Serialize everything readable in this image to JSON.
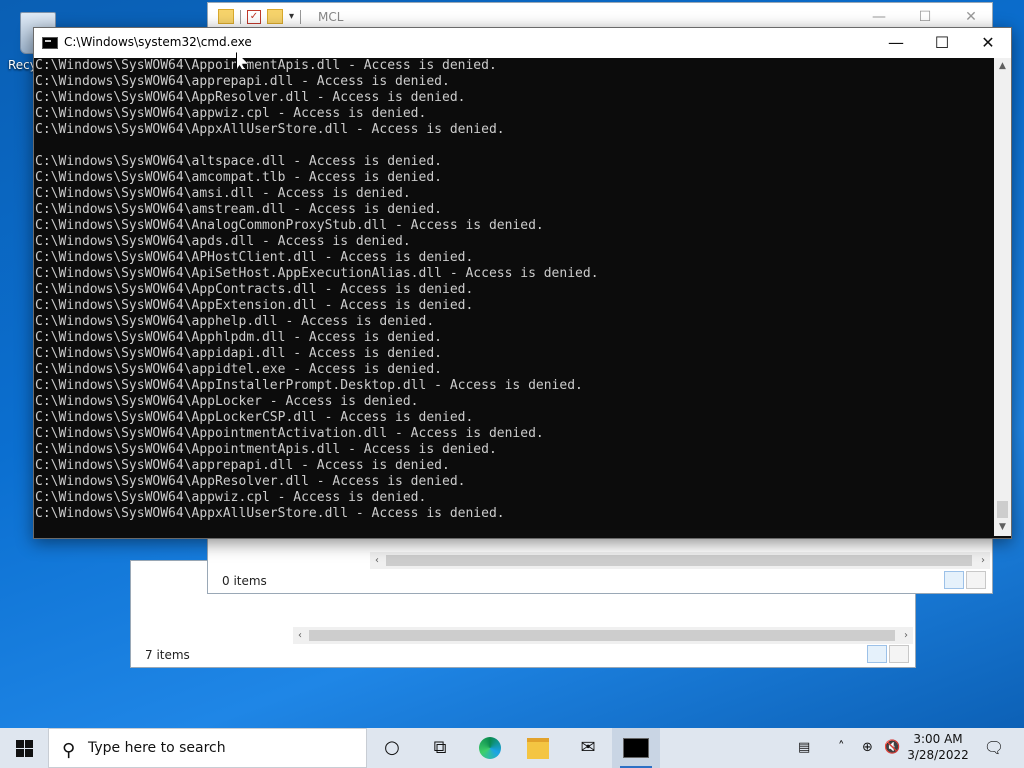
{
  "desktop": {
    "recycle_bin_label": "Recyc"
  },
  "explorer_back": {
    "status": "7 items"
  },
  "explorer_front": {
    "title": "MCL",
    "status": "0 items"
  },
  "cmd": {
    "title": "C:\\Windows\\system32\\cmd.exe",
    "lines": [
      "C:\\Windows\\SysWOW64\\AppointmentApis.dll - Access is denied.",
      "C:\\Windows\\SysWOW64\\apprepapi.dll - Access is denied.",
      "C:\\Windows\\SysWOW64\\AppResolver.dll - Access is denied.",
      "C:\\Windows\\SysWOW64\\appwiz.cpl - Access is denied.",
      "C:\\Windows\\SysWOW64\\AppxAllUserStore.dll - Access is denied.",
      "",
      "C:\\Windows\\SysWOW64\\altspace.dll - Access is denied.",
      "C:\\Windows\\SysWOW64\\amcompat.tlb - Access is denied.",
      "C:\\Windows\\SysWOW64\\amsi.dll - Access is denied.",
      "C:\\Windows\\SysWOW64\\amstream.dll - Access is denied.",
      "C:\\Windows\\SysWOW64\\AnalogCommonProxyStub.dll - Access is denied.",
      "C:\\Windows\\SysWOW64\\apds.dll - Access is denied.",
      "C:\\Windows\\SysWOW64\\APHostClient.dll - Access is denied.",
      "C:\\Windows\\SysWOW64\\ApiSetHost.AppExecutionAlias.dll - Access is denied.",
      "C:\\Windows\\SysWOW64\\AppContracts.dll - Access is denied.",
      "C:\\Windows\\SysWOW64\\AppExtension.dll - Access is denied.",
      "C:\\Windows\\SysWOW64\\apphelp.dll - Access is denied.",
      "C:\\Windows\\SysWOW64\\Apphlpdm.dll - Access is denied.",
      "C:\\Windows\\SysWOW64\\appidapi.dll - Access is denied.",
      "C:\\Windows\\SysWOW64\\appidtel.exe - Access is denied.",
      "C:\\Windows\\SysWOW64\\AppInstallerPrompt.Desktop.dll - Access is denied.",
      "C:\\Windows\\SysWOW64\\AppLocker - Access is denied.",
      "C:\\Windows\\SysWOW64\\AppLockerCSP.dll - Access is denied.",
      "C:\\Windows\\SysWOW64\\AppointmentActivation.dll - Access is denied.",
      "C:\\Windows\\SysWOW64\\AppointmentApis.dll - Access is denied.",
      "C:\\Windows\\SysWOW64\\apprepapi.dll - Access is denied.",
      "C:\\Windows\\SysWOW64\\AppResolver.dll - Access is denied.",
      "C:\\Windows\\SysWOW64\\appwiz.cpl - Access is denied.",
      "C:\\Windows\\SysWOW64\\AppxAllUserStore.dll - Access is denied."
    ]
  },
  "taskbar": {
    "search_placeholder": "Type here to search",
    "time": "3:00 AM",
    "date": "3/28/2022"
  }
}
